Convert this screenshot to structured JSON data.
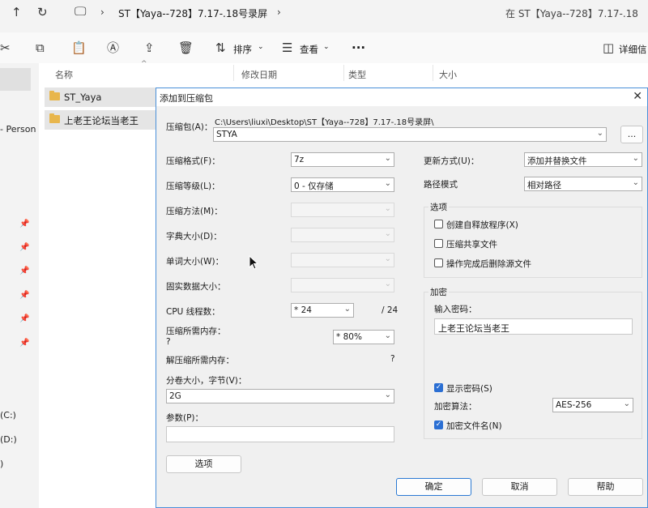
{
  "explorer": {
    "address_path": "ST【Yaya--728】7.17-.18号录屏",
    "search_placeholder": "在 ST【Yaya--728】7.17-.18",
    "toolbar": {
      "sort_label": "排序",
      "view_label": "查看",
      "more_label": "···",
      "details_label": "详细信"
    },
    "columns": [
      "名称",
      "修改日期",
      "类型",
      "大小"
    ],
    "files": [
      {
        "name": "ST_Yaya"
      },
      {
        "name": "上老王论坛当老王"
      }
    ],
    "nav": {
      "personal_partial": "- Person",
      "drive_c": "(C:)",
      "drive_d": "(D:)",
      "drive_partial": ")"
    }
  },
  "dialog": {
    "title": "添加到压缩包",
    "archive_label": "压缩包(A)：",
    "archive_path": "C:\\Users\\liuxi\\Desktop\\ST【Yaya--728】7.17-.18号录屏\\",
    "archive_name": "STYA",
    "browse_label": "...",
    "left": {
      "format_label": "压缩格式(F)：",
      "format_value": "7z",
      "level_label": "压缩等级(L)：",
      "level_value": "0 - 仅存储",
      "method_label": "压缩方法(M)：",
      "dict_label": "字典大小(D)：",
      "word_label": "单词大小(W)：",
      "solid_label": "固实数据大小：",
      "cpu_label": "CPU 线程数：",
      "cpu_value": "* 24",
      "cpu_total": "/ 24",
      "mem_label": "压缩所需内存：",
      "mem_value_q": "?",
      "mem_percent": "* 80%",
      "decomp_label": "解压缩所需内存：",
      "decomp_value": "?",
      "split_label": "分卷大小，字节(V)：",
      "split_value": "2G",
      "params_label": "参数(P)：",
      "options_button": "选项"
    },
    "right": {
      "update_label": "更新方式(U)：",
      "update_value": "添加并替换文件",
      "path_label": "路径模式",
      "path_value": "相对路径",
      "options_group": "选项",
      "opt_sfx": "创建自释放程序(X)",
      "opt_shared": "压缩共享文件",
      "opt_delete": "操作完成后删除源文件",
      "encrypt_group": "加密",
      "pwd_label": "输入密码：",
      "pwd_value": "上老王论坛当老王",
      "show_pwd": "显示密码(S)",
      "enc_method_label": "加密算法：",
      "enc_method_value": "AES-256",
      "enc_names": "加密文件名(N)"
    },
    "buttons": {
      "ok": "确定",
      "cancel": "取消",
      "help": "帮助"
    }
  }
}
